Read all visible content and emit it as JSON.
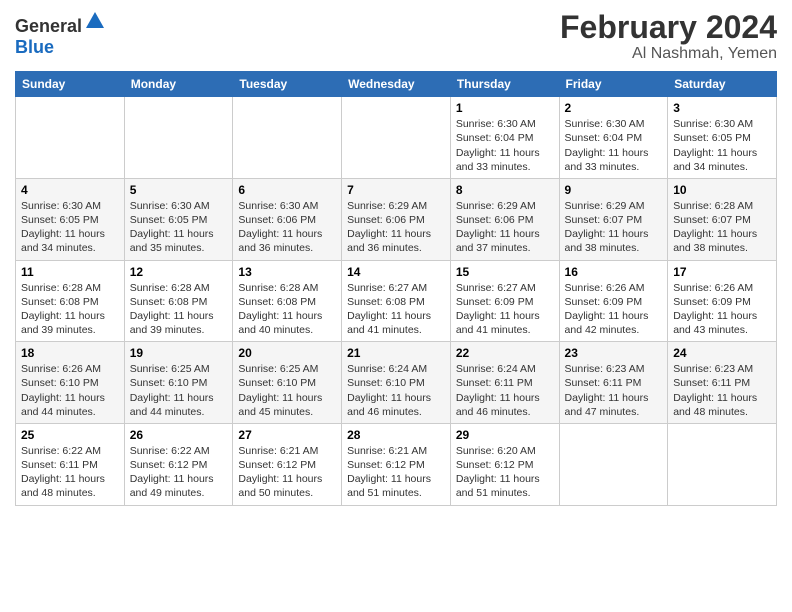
{
  "header": {
    "logo_general": "General",
    "logo_blue": "Blue",
    "title": "February 2024",
    "subtitle": "Al Nashmah, Yemen"
  },
  "days_of_week": [
    "Sunday",
    "Monday",
    "Tuesday",
    "Wednesday",
    "Thursday",
    "Friday",
    "Saturday"
  ],
  "weeks": [
    {
      "days": [
        {
          "num": "",
          "info": ""
        },
        {
          "num": "",
          "info": ""
        },
        {
          "num": "",
          "info": ""
        },
        {
          "num": "",
          "info": ""
        },
        {
          "num": "1",
          "info": "Sunrise: 6:30 AM\nSunset: 6:04 PM\nDaylight: 11 hours\nand 33 minutes."
        },
        {
          "num": "2",
          "info": "Sunrise: 6:30 AM\nSunset: 6:04 PM\nDaylight: 11 hours\nand 33 minutes."
        },
        {
          "num": "3",
          "info": "Sunrise: 6:30 AM\nSunset: 6:05 PM\nDaylight: 11 hours\nand 34 minutes."
        }
      ]
    },
    {
      "days": [
        {
          "num": "4",
          "info": "Sunrise: 6:30 AM\nSunset: 6:05 PM\nDaylight: 11 hours\nand 34 minutes."
        },
        {
          "num": "5",
          "info": "Sunrise: 6:30 AM\nSunset: 6:05 PM\nDaylight: 11 hours\nand 35 minutes."
        },
        {
          "num": "6",
          "info": "Sunrise: 6:30 AM\nSunset: 6:06 PM\nDaylight: 11 hours\nand 36 minutes."
        },
        {
          "num": "7",
          "info": "Sunrise: 6:29 AM\nSunset: 6:06 PM\nDaylight: 11 hours\nand 36 minutes."
        },
        {
          "num": "8",
          "info": "Sunrise: 6:29 AM\nSunset: 6:06 PM\nDaylight: 11 hours\nand 37 minutes."
        },
        {
          "num": "9",
          "info": "Sunrise: 6:29 AM\nSunset: 6:07 PM\nDaylight: 11 hours\nand 38 minutes."
        },
        {
          "num": "10",
          "info": "Sunrise: 6:28 AM\nSunset: 6:07 PM\nDaylight: 11 hours\nand 38 minutes."
        }
      ]
    },
    {
      "days": [
        {
          "num": "11",
          "info": "Sunrise: 6:28 AM\nSunset: 6:08 PM\nDaylight: 11 hours\nand 39 minutes."
        },
        {
          "num": "12",
          "info": "Sunrise: 6:28 AM\nSunset: 6:08 PM\nDaylight: 11 hours\nand 39 minutes."
        },
        {
          "num": "13",
          "info": "Sunrise: 6:28 AM\nSunset: 6:08 PM\nDaylight: 11 hours\nand 40 minutes."
        },
        {
          "num": "14",
          "info": "Sunrise: 6:27 AM\nSunset: 6:08 PM\nDaylight: 11 hours\nand 41 minutes."
        },
        {
          "num": "15",
          "info": "Sunrise: 6:27 AM\nSunset: 6:09 PM\nDaylight: 11 hours\nand 41 minutes."
        },
        {
          "num": "16",
          "info": "Sunrise: 6:26 AM\nSunset: 6:09 PM\nDaylight: 11 hours\nand 42 minutes."
        },
        {
          "num": "17",
          "info": "Sunrise: 6:26 AM\nSunset: 6:09 PM\nDaylight: 11 hours\nand 43 minutes."
        }
      ]
    },
    {
      "days": [
        {
          "num": "18",
          "info": "Sunrise: 6:26 AM\nSunset: 6:10 PM\nDaylight: 11 hours\nand 44 minutes."
        },
        {
          "num": "19",
          "info": "Sunrise: 6:25 AM\nSunset: 6:10 PM\nDaylight: 11 hours\nand 44 minutes."
        },
        {
          "num": "20",
          "info": "Sunrise: 6:25 AM\nSunset: 6:10 PM\nDaylight: 11 hours\nand 45 minutes."
        },
        {
          "num": "21",
          "info": "Sunrise: 6:24 AM\nSunset: 6:10 PM\nDaylight: 11 hours\nand 46 minutes."
        },
        {
          "num": "22",
          "info": "Sunrise: 6:24 AM\nSunset: 6:11 PM\nDaylight: 11 hours\nand 46 minutes."
        },
        {
          "num": "23",
          "info": "Sunrise: 6:23 AM\nSunset: 6:11 PM\nDaylight: 11 hours\nand 47 minutes."
        },
        {
          "num": "24",
          "info": "Sunrise: 6:23 AM\nSunset: 6:11 PM\nDaylight: 11 hours\nand 48 minutes."
        }
      ]
    },
    {
      "days": [
        {
          "num": "25",
          "info": "Sunrise: 6:22 AM\nSunset: 6:11 PM\nDaylight: 11 hours\nand 48 minutes."
        },
        {
          "num": "26",
          "info": "Sunrise: 6:22 AM\nSunset: 6:12 PM\nDaylight: 11 hours\nand 49 minutes."
        },
        {
          "num": "27",
          "info": "Sunrise: 6:21 AM\nSunset: 6:12 PM\nDaylight: 11 hours\nand 50 minutes."
        },
        {
          "num": "28",
          "info": "Sunrise: 6:21 AM\nSunset: 6:12 PM\nDaylight: 11 hours\nand 51 minutes."
        },
        {
          "num": "29",
          "info": "Sunrise: 6:20 AM\nSunset: 6:12 PM\nDaylight: 11 hours\nand 51 minutes."
        },
        {
          "num": "",
          "info": ""
        },
        {
          "num": "",
          "info": ""
        }
      ]
    }
  ]
}
